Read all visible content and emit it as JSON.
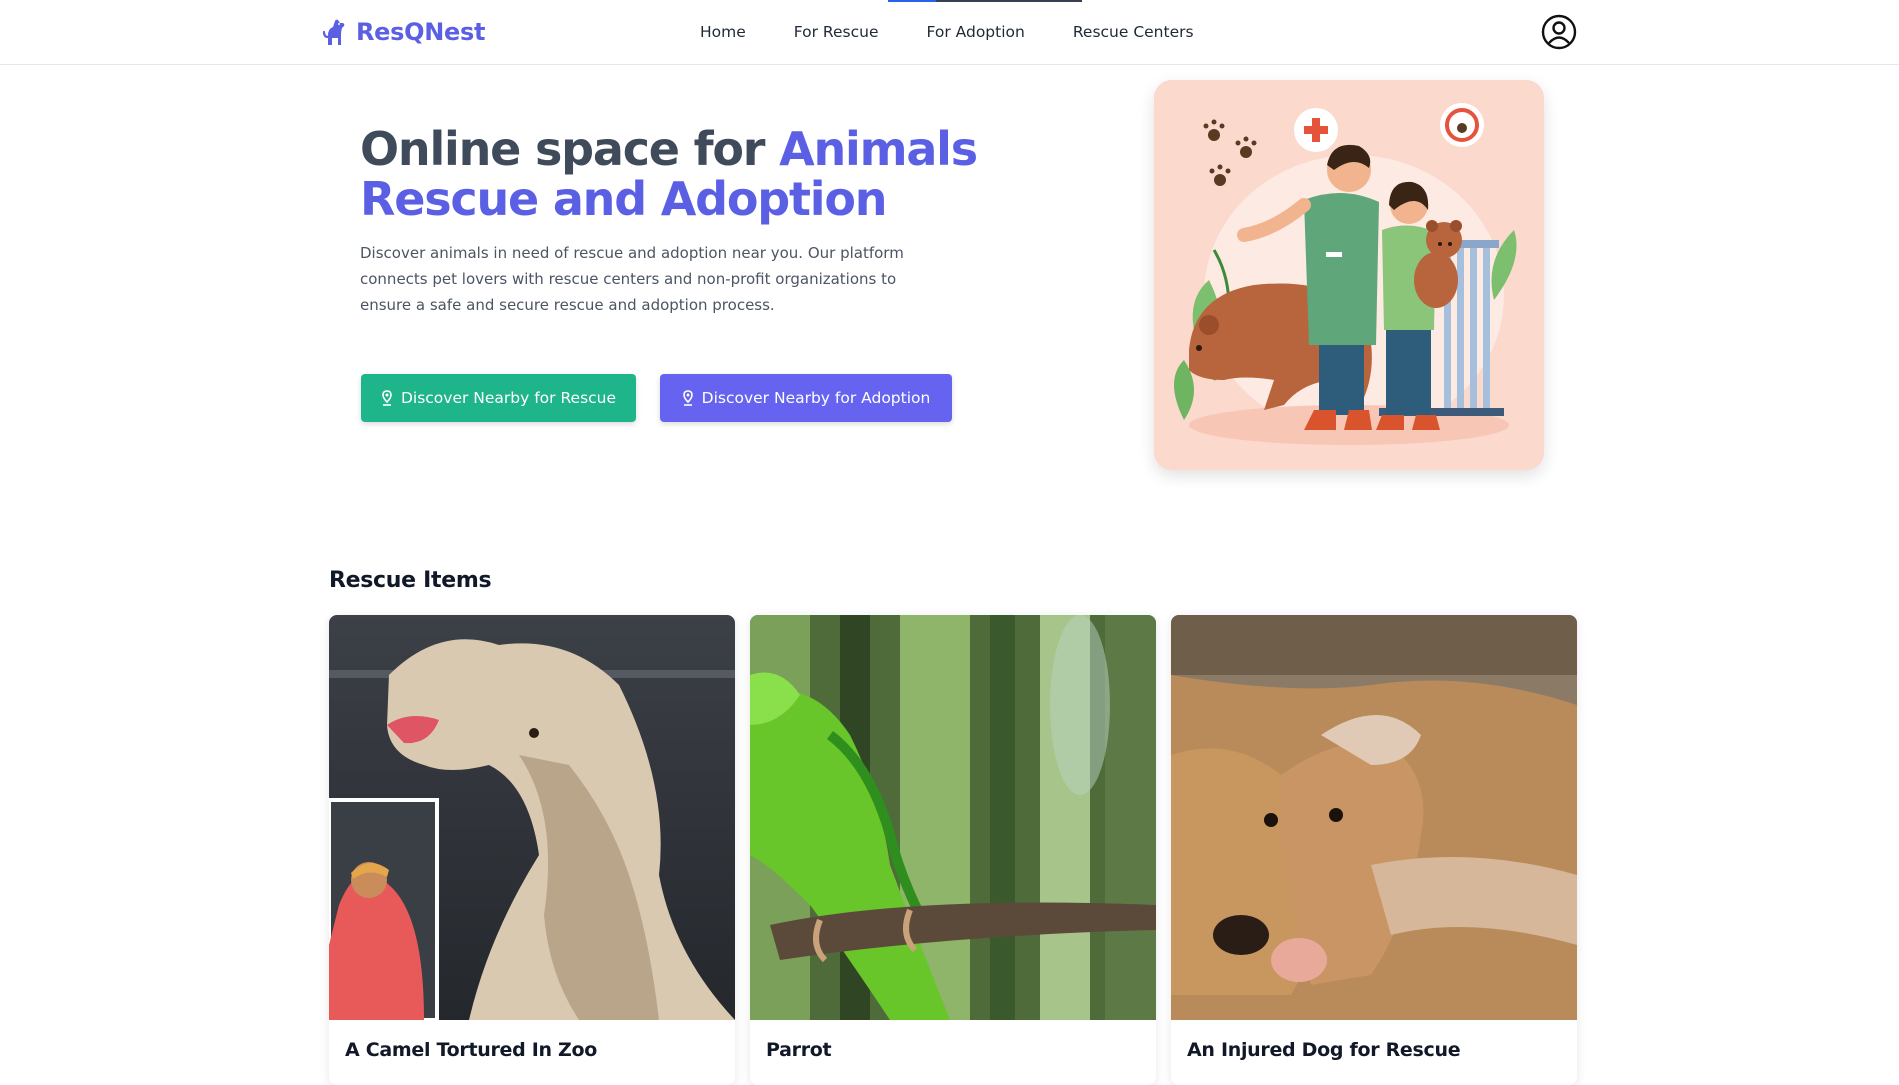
{
  "brand": {
    "name": "ResQNest",
    "icon": "dog-icon",
    "color": "#5b5fe4"
  },
  "nav": {
    "links": [
      "Home",
      "For Rescue",
      "For Adoption",
      "Rescue Centers"
    ],
    "user_icon": "user-circle-icon"
  },
  "hero": {
    "title_plain": "Online space for ",
    "title_accent": "Animals Rescue and Adoption",
    "description": "Discover animals in need of rescue and adoption near you. Our platform connects pet lovers with rescue centers and non-profit organizations to ensure a safe and secure rescue and adoption process.",
    "buttons": [
      {
        "label": "Discover Nearby for Rescue",
        "icon": "location-pin-icon",
        "color": "#1fb58a"
      },
      {
        "label": "Discover Nearby for Adoption",
        "icon": "location-pin-icon",
        "color": "#6663f0"
      }
    ],
    "illustration": "rescuers-with-bear-illustration"
  },
  "rescue_items": {
    "title": "Rescue Items",
    "cards": [
      {
        "title": "A Camel Tortured In Zoo",
        "image": "camel-photo"
      },
      {
        "title": "Parrot",
        "image": "parrot-photo"
      },
      {
        "title": "An Injured Dog for Rescue",
        "image": "dog-photo"
      }
    ]
  },
  "colors": {
    "accent": "#5b5fe4",
    "rescue_green": "#1fb58a",
    "adopt_purple": "#6663f0",
    "heading": "#3f4a5a"
  }
}
